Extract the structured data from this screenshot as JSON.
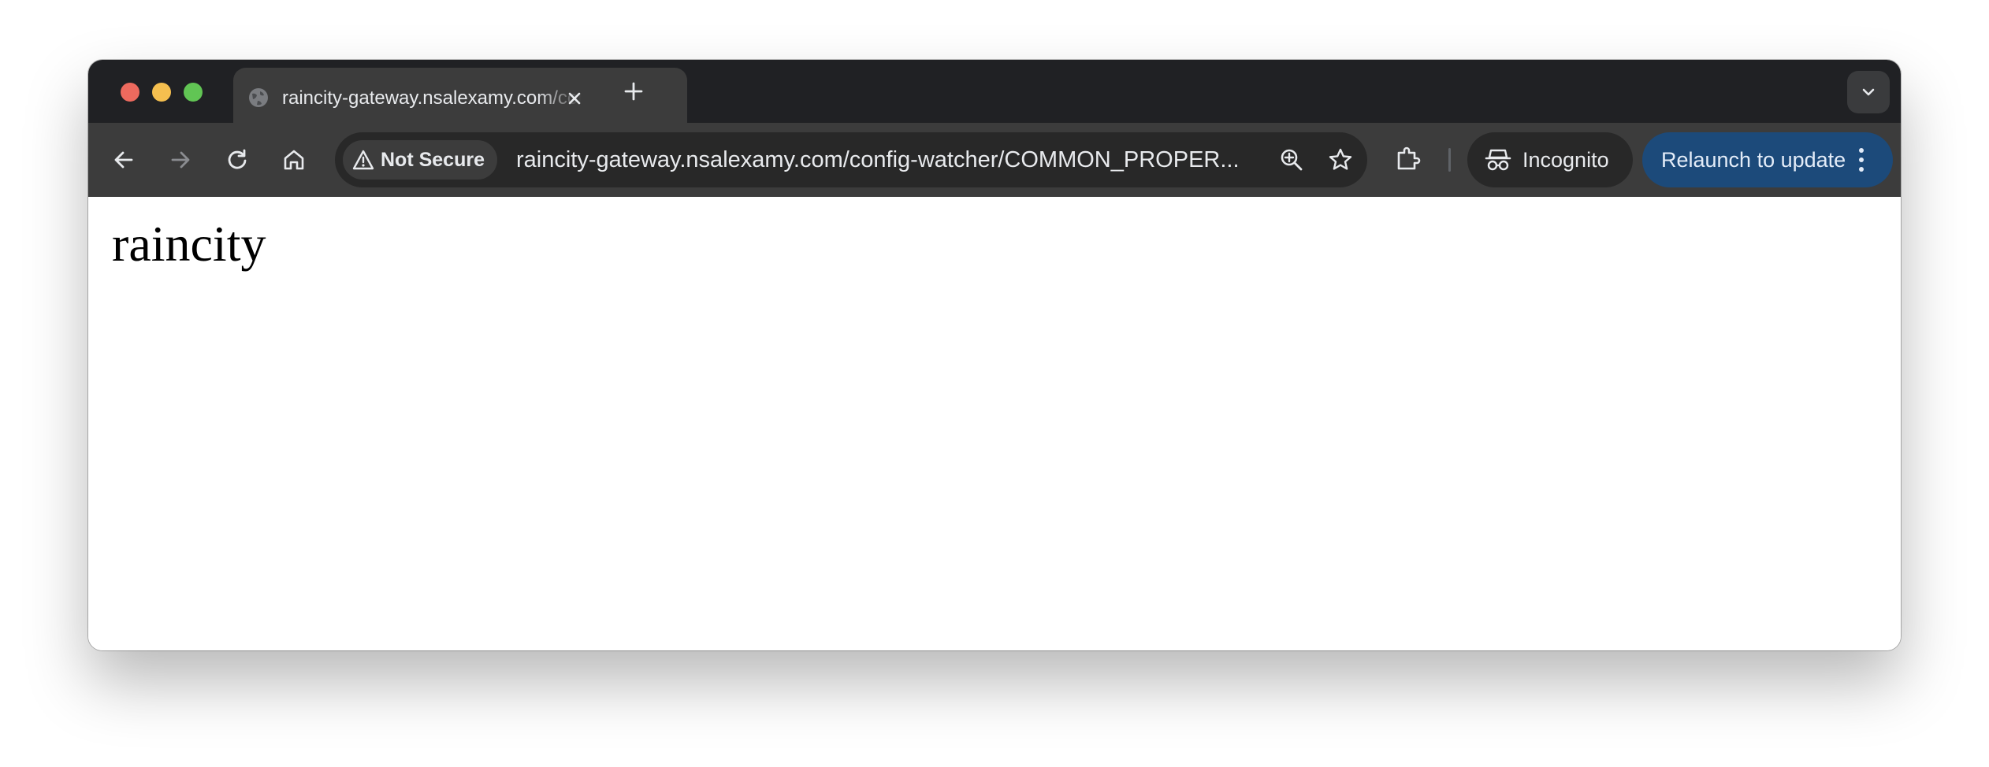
{
  "browser": {
    "tab": {
      "title": "raincity-gateway.nsalexamy.com/config-watcher/COMMON_PROPERTIES",
      "favicon": "globe-icon",
      "close_icon": "close-icon"
    },
    "new_tab_icon": "plus-icon",
    "tab_search_icon": "chevron-down-icon",
    "toolbar": {
      "back_icon": "back-arrow-icon",
      "forward_icon": "forward-arrow-icon",
      "reload_icon": "reload-icon",
      "home_icon": "home-icon",
      "security_chip": {
        "icon": "warning-icon",
        "label": "Not Secure"
      },
      "url": "raincity-gateway.nsalexamy.com/config-watcher/COMMON_PROPER...",
      "zoom_icon": "zoom-icon",
      "bookmark_icon": "star-icon",
      "extensions_icon": "puzzle-icon",
      "incognito": {
        "icon": "incognito-icon",
        "label": "Incognito"
      },
      "relaunch": {
        "label": "Relaunch to update",
        "menu_icon": "kebab-menu-icon"
      }
    },
    "colors": {
      "tabstrip": "#202124",
      "toolbar": "#3c3c3c",
      "relaunch_button": "#1c4a7a"
    }
  },
  "page": {
    "heading": "raincity"
  }
}
